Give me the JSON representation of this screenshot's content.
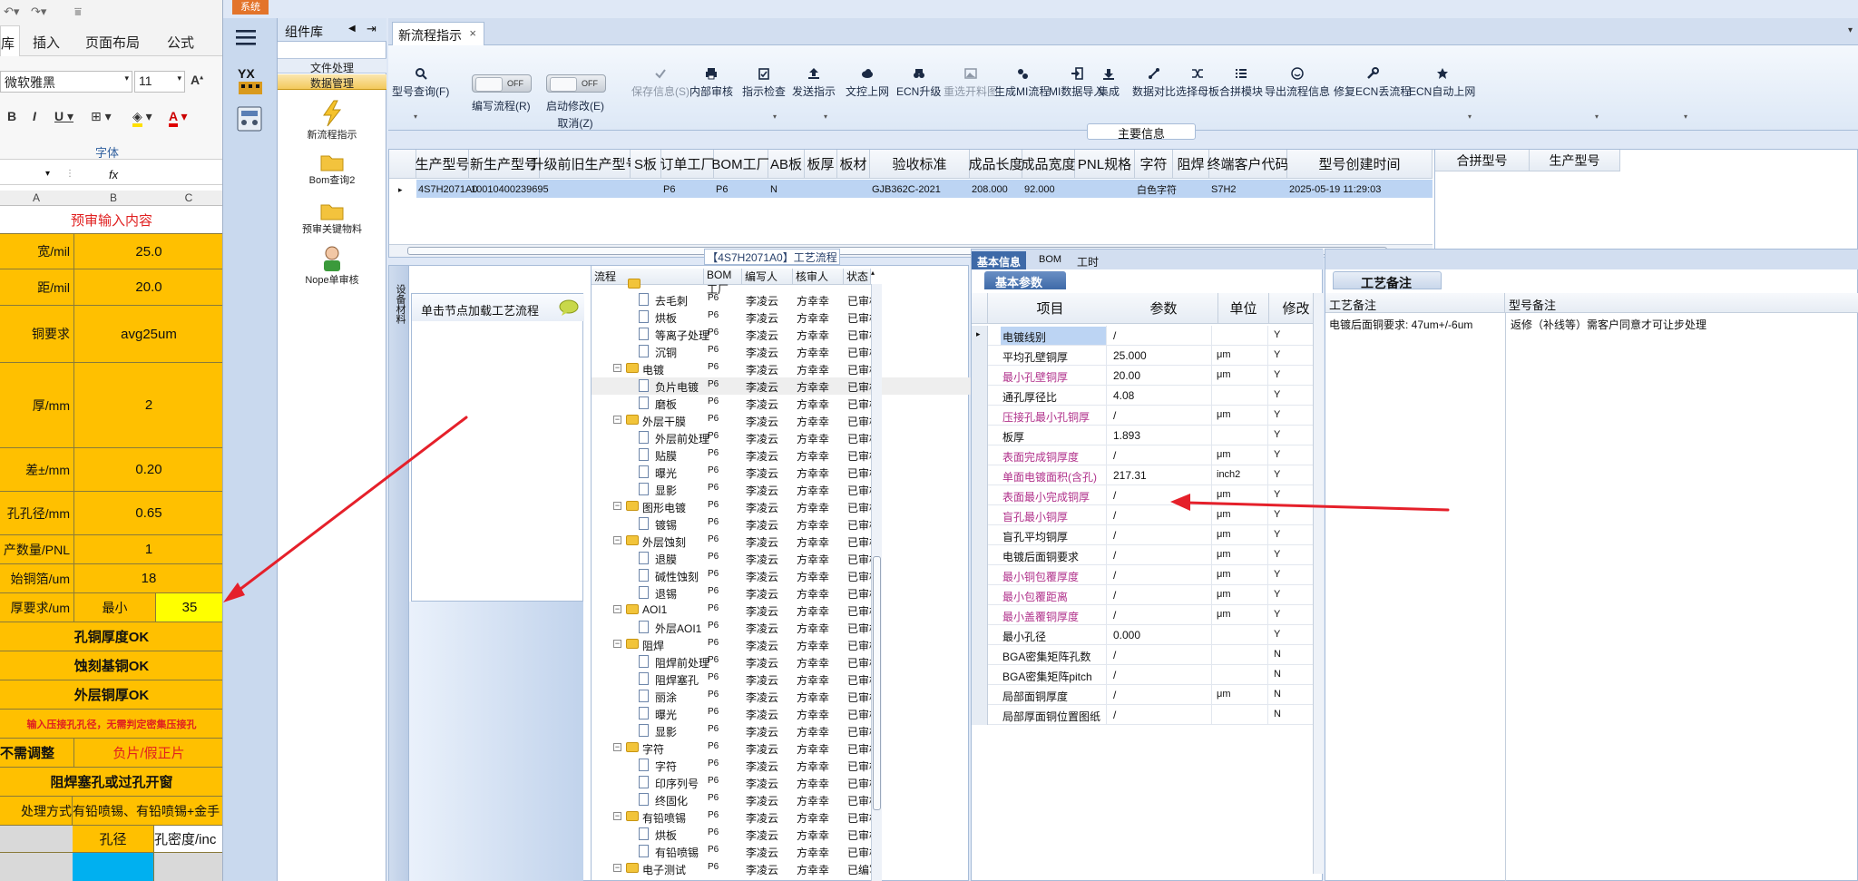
{
  "excel": {
    "qat_icons": [
      "undo-icon",
      "redo-icon"
    ],
    "tabs": [
      "库",
      "插入",
      "页面布局",
      "公式"
    ],
    "font_name": "微软雅黑",
    "font_size": "11",
    "font_group_label": "字体",
    "formula_fx": "fx",
    "columns": [
      "A",
      "B",
      "C"
    ],
    "title_row": "预审输入内容",
    "rows": [
      {
        "label": "宽/mil",
        "value": "25.0"
      },
      {
        "label": "距/mil",
        "value": "20.0"
      },
      {
        "label": "铜要求",
        "value": "avg25um"
      },
      {
        "label": "厚/mm",
        "value": "2"
      },
      {
        "label": "差±/mm",
        "value": "0.20"
      },
      {
        "label": "孔孔径/mm",
        "value": "0.65"
      },
      {
        "label": "产数量/PNL",
        "value": "1"
      },
      {
        "label": "始铜箔/um",
        "value": "18"
      },
      {
        "label": "厚要求/um",
        "sub": "最小",
        "value": "35"
      }
    ],
    "status_rows": [
      "孔铜厚度OK",
      "蚀刻基铜OK",
      "外层铜厚OK"
    ],
    "warning": "输入压接孔孔径，无需判定密集压接孔",
    "adjust_left": "不需调整",
    "adjust_right": "负片/假正片",
    "solder": "阻焊塞孔或过孔开窗",
    "process_label": "处理方式",
    "process_value": "有铅喷锡、有铅喷锡+金手",
    "header_b": "孔径",
    "header_c": "孔密度/inc"
  },
  "app": {
    "system_tab": "系统",
    "lib_title": "组件库",
    "lib_nav_left": "◀",
    "lib_nav_right": "⇥",
    "lib_groups": [
      "文件处理",
      "数据管理"
    ],
    "lib_items": [
      "新流程指示",
      "Bom查询2",
      "预审关键物料",
      "Nope单审核"
    ],
    "doc_tab": "新流程指示",
    "doc_tab_close": "×",
    "toolbar": [
      {
        "label": "型号查询(F)",
        "icon": "search-icon"
      },
      {
        "label": "编写流程(R)",
        "toggle": "OFF"
      },
      {
        "label": "启动修改(E)",
        "toggle": "OFF",
        "sub": "取消(Z)"
      },
      {
        "label": "保存信息(S)",
        "icon": "check-icon",
        "disabled": true
      },
      {
        "label": "内部审核",
        "icon": "printer-icon"
      },
      {
        "label": "指示检查",
        "icon": "clipboard-icon"
      },
      {
        "label": "发送指示",
        "icon": "upload-icon"
      },
      {
        "label": "文控上网",
        "icon": "cloud-icon"
      },
      {
        "label": "ECN升级",
        "icon": "binoculars-icon"
      },
      {
        "label": "重选开料图",
        "icon": "image-icon",
        "disabled": true
      },
      {
        "label": "生成MI流程",
        "icon": "gears-icon"
      },
      {
        "label": "MI数据导入",
        "icon": "import-icon"
      },
      {
        "label": "集成",
        "icon": "download-icon"
      },
      {
        "label": "数据对比",
        "icon": "compare-icon"
      },
      {
        "label": "选择母板",
        "icon": "shuffle-icon"
      },
      {
        "label": "合拼模块",
        "icon": "list-icon"
      },
      {
        "label": "导出流程信息",
        "icon": "smile-icon"
      },
      {
        "label": "修复ECN丢流程",
        "icon": "wrench-icon"
      },
      {
        "label": "ECN自动上网",
        "icon": "star-icon"
      }
    ],
    "main_info_title": "主要信息",
    "main_grid_headers": [
      "生产型号",
      "新生产型号",
      "升级前旧生产型号",
      "S板",
      "订单工厂",
      "BOM工厂",
      "AB板",
      "板厚",
      "板材",
      "验收标准",
      "成品长度",
      "成品宽度",
      "PNL规格",
      "字符",
      "阻焊",
      "终端客户代码",
      "型号创建时间"
    ],
    "main_grid_row": [
      "4S7H2071A0",
      "10010400239695",
      "",
      "",
      "P6",
      "P6",
      "N",
      "",
      "",
      "GJB362C-2021",
      "208.000",
      "92.000",
      "",
      "白色字符",
      "",
      "S7H2",
      "2025-05-19 11:29:03"
    ],
    "merge_headers": [
      "合拼型号",
      "生产型号"
    ],
    "flow_title": "【4S7H2071A0】工艺流程",
    "side_strip_label": "设备材料",
    "load_text": "单击节点加载工艺流程",
    "tree_headers": [
      "流程",
      "BOM工厂",
      "编写人",
      "核审人",
      "状态"
    ],
    "tree_rows": [
      {
        "name": "去毛刺",
        "level": 2,
        "f": "P6",
        "w": "李凌云",
        "r": "方幸幸",
        "s": "已审核"
      },
      {
        "name": "烘板",
        "level": 2,
        "f": "P6",
        "w": "李凌云",
        "r": "方幸幸",
        "s": "已审核"
      },
      {
        "name": "等离子处理",
        "level": 2,
        "f": "P6",
        "w": "李凌云",
        "r": "方幸幸",
        "s": "已审核"
      },
      {
        "name": "沉铜",
        "level": 2,
        "f": "P6",
        "w": "李凌云",
        "r": "方幸幸",
        "s": "已审核"
      },
      {
        "name": "电镀",
        "level": 1,
        "f": "P6",
        "w": "李凌云",
        "r": "方幸幸",
        "s": "已审核"
      },
      {
        "name": "负片电镀",
        "level": 2,
        "f": "P6",
        "w": "李凌云",
        "r": "方幸幸",
        "s": "已审核"
      },
      {
        "name": "磨板",
        "level": 2,
        "f": "P6",
        "w": "李凌云",
        "r": "方幸幸",
        "s": "已审核"
      },
      {
        "name": "外层干膜",
        "level": 1,
        "f": "P6",
        "w": "李凌云",
        "r": "方幸幸",
        "s": "已审核"
      },
      {
        "name": "外层前处理",
        "level": 2,
        "f": "P6",
        "w": "李凌云",
        "r": "方幸幸",
        "s": "已审核"
      },
      {
        "name": "贴膜",
        "level": 2,
        "f": "P6",
        "w": "李凌云",
        "r": "方幸幸",
        "s": "已审核"
      },
      {
        "name": "曝光",
        "level": 2,
        "f": "P6",
        "w": "李凌云",
        "r": "方幸幸",
        "s": "已审核"
      },
      {
        "name": "显影",
        "level": 2,
        "f": "P6",
        "w": "李凌云",
        "r": "方幸幸",
        "s": "已审核"
      },
      {
        "name": "图形电镀",
        "level": 1,
        "f": "P6",
        "w": "李凌云",
        "r": "方幸幸",
        "s": "已审核"
      },
      {
        "name": "镀锡",
        "level": 2,
        "f": "P6",
        "w": "李凌云",
        "r": "方幸幸",
        "s": "已审核"
      },
      {
        "name": "外层蚀刻",
        "level": 1,
        "f": "P6",
        "w": "李凌云",
        "r": "方幸幸",
        "s": "已审核"
      },
      {
        "name": "退膜",
        "level": 2,
        "f": "P6",
        "w": "李凌云",
        "r": "方幸幸",
        "s": "已审核"
      },
      {
        "name": "碱性蚀刻",
        "level": 2,
        "f": "P6",
        "w": "李凌云",
        "r": "方幸幸",
        "s": "已审核"
      },
      {
        "name": "退锡",
        "level": 2,
        "f": "P6",
        "w": "李凌云",
        "r": "方幸幸",
        "s": "已审核"
      },
      {
        "name": "AOI1",
        "level": 1,
        "f": "P6",
        "w": "李凌云",
        "r": "方幸幸",
        "s": "已审核"
      },
      {
        "name": "外层AOI1",
        "level": 2,
        "f": "P6",
        "w": "李凌云",
        "r": "方幸幸",
        "s": "已审核"
      },
      {
        "name": "阻焊",
        "level": 1,
        "f": "P6",
        "w": "李凌云",
        "r": "方幸幸",
        "s": "已审核"
      },
      {
        "name": "阻焊前处理",
        "level": 2,
        "f": "P6",
        "w": "李凌云",
        "r": "方幸幸",
        "s": "已审核"
      },
      {
        "name": "阻焊塞孔",
        "level": 2,
        "f": "P6",
        "w": "李凌云",
        "r": "方幸幸",
        "s": "已审核"
      },
      {
        "name": "丽涂",
        "level": 2,
        "f": "P6",
        "w": "李凌云",
        "r": "方幸幸",
        "s": "已审核"
      },
      {
        "name": "曝光",
        "level": 2,
        "f": "P6",
        "w": "李凌云",
        "r": "方幸幸",
        "s": "已审核"
      },
      {
        "name": "显影",
        "level": 2,
        "f": "P6",
        "w": "李凌云",
        "r": "方幸幸",
        "s": "已审核"
      },
      {
        "name": "字符",
        "level": 1,
        "f": "P6",
        "w": "李凌云",
        "r": "方幸幸",
        "s": "已审核"
      },
      {
        "name": "字符",
        "level": 2,
        "f": "P6",
        "w": "李凌云",
        "r": "方幸幸",
        "s": "已审核"
      },
      {
        "name": "印序列号",
        "level": 2,
        "f": "P6",
        "w": "李凌云",
        "r": "方幸幸",
        "s": "已审核"
      },
      {
        "name": "终固化",
        "level": 2,
        "f": "P6",
        "w": "李凌云",
        "r": "方幸幸",
        "s": "已审核"
      },
      {
        "name": "有铅喷锡",
        "level": 1,
        "f": "P6",
        "w": "李凌云",
        "r": "方幸幸",
        "s": "已审核"
      },
      {
        "name": "烘板",
        "level": 2,
        "f": "P6",
        "w": "李凌云",
        "r": "方幸幸",
        "s": "已审核"
      },
      {
        "name": "有铅喷锡",
        "level": 2,
        "f": "P6",
        "w": "李凌云",
        "r": "方幸幸",
        "s": "已审核"
      },
      {
        "name": "电子测试",
        "level": 1,
        "f": "P6",
        "w": "李凌云",
        "r": "方幸幸",
        "s": "已编写"
      }
    ],
    "basic_tabs": [
      "基本信息",
      "BOM",
      "工时"
    ],
    "basic_sub": "基本参数",
    "param_headers": [
      "项目",
      "参数",
      "单位",
      "修改"
    ],
    "params": [
      {
        "label": "电镀线别",
        "value": "/",
        "unit": "",
        "mod": "Y",
        "pink": false,
        "selected": true
      },
      {
        "label": "平均孔壁铜厚",
        "value": "25.000",
        "unit": "μm",
        "mod": "Y",
        "pink": false
      },
      {
        "label": "最小孔壁铜厚",
        "value": "20.00",
        "unit": "μm",
        "mod": "Y",
        "pink": true
      },
      {
        "label": "通孔厚径比",
        "value": "4.08",
        "unit": "",
        "mod": "Y",
        "pink": false
      },
      {
        "label": "压接孔最小孔铜厚",
        "value": "/",
        "unit": "μm",
        "mod": "Y",
        "pink": true
      },
      {
        "label": "板厚",
        "value": "1.893",
        "unit": "",
        "mod": "Y",
        "pink": false
      },
      {
        "label": "表面完成铜厚度",
        "value": "/",
        "unit": "μm",
        "mod": "Y",
        "pink": true
      },
      {
        "label": "单面电镀面积(含孔)",
        "value": "217.31",
        "unit": "inch2",
        "mod": "Y",
        "pink": true
      },
      {
        "label": "表面最小完成铜厚",
        "value": "/",
        "unit": "μm",
        "mod": "Y",
        "pink": true
      },
      {
        "label": "盲孔最小铜厚",
        "value": "/",
        "unit": "μm",
        "mod": "Y",
        "pink": true
      },
      {
        "label": "盲孔平均铜厚",
        "value": "/",
        "unit": "μm",
        "mod": "Y",
        "pink": false
      },
      {
        "label": "电镀后面铜要求",
        "value": "/",
        "unit": "μm",
        "mod": "Y",
        "pink": false
      },
      {
        "label": "最小铜包覆厚度",
        "value": "/",
        "unit": "μm",
        "mod": "Y",
        "pink": true
      },
      {
        "label": "最小包覆距离",
        "value": "/",
        "unit": "μm",
        "mod": "Y",
        "pink": true
      },
      {
        "label": "最小盖覆铜厚度",
        "value": "/",
        "unit": "μm",
        "mod": "Y",
        "pink": true
      },
      {
        "label": "最小孔径",
        "value": "0.000",
        "unit": "",
        "mod": "Y",
        "pink": false
      },
      {
        "label": "BGA密集矩阵孔数",
        "value": "/",
        "unit": "",
        "mod": "N",
        "pink": false
      },
      {
        "label": "BGA密集矩阵pitch",
        "value": "/",
        "unit": "",
        "mod": "N",
        "pink": false
      },
      {
        "label": "局部面铜厚度",
        "value": "/",
        "unit": "μm",
        "mod": "N",
        "pink": false
      },
      {
        "label": "局部厚面铜位置图纸",
        "value": "/",
        "unit": "",
        "mod": "N",
        "pink": false
      }
    ],
    "remark_sub": "工艺备注",
    "remark_headers": [
      "工艺备注",
      "型号备注"
    ],
    "remark_value": "电镀后面铜要求: 47um+/-6um",
    "model_remark_value": "返修（补线等）需客户同意才可让步处理",
    "accent_color": "#3e6aa8",
    "pink_color": "#b0318b",
    "annotation_color": "#e5202a"
  }
}
